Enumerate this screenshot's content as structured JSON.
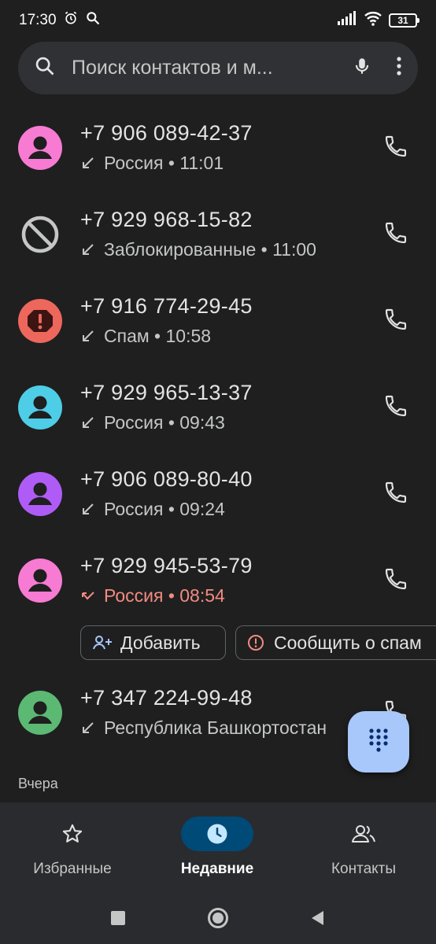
{
  "status_bar": {
    "time": "17:30",
    "battery": "31"
  },
  "search": {
    "placeholder": "Поиск контактов и м..."
  },
  "calls": [
    {
      "number": "+7 906 089-42-37",
      "info": "Россия • 11:01",
      "avatar_color": "#f77bd2",
      "type": "incoming"
    },
    {
      "number": "+7 929 968-15-82",
      "info": "Заблокированные • 11:00",
      "avatar_color": "none",
      "type": "blocked"
    },
    {
      "number": "+7 916 774-29-45",
      "info": "Спам • 10:58",
      "avatar_color": "#ee675c",
      "type": "spam"
    },
    {
      "number": "+7 929 965-13-37",
      "info": "Россия • 09:43",
      "avatar_color": "#4ecde6",
      "type": "incoming"
    },
    {
      "number": "+7 906 089-80-40",
      "info": "Россия • 09:24",
      "avatar_color": "#af5cf7",
      "type": "incoming"
    },
    {
      "number": "+7 929 945-53-79",
      "info": "Россия • 08:54",
      "avatar_color": "#f77bd2",
      "type": "missed"
    },
    {
      "number": "+7 347 224-99-48",
      "info": "Республика Башкортостан",
      "avatar_color": "#5bb974",
      "type": "incoming"
    }
  ],
  "actions": {
    "add_label": "Добавить",
    "report_spam_label": "Сообщить о спам"
  },
  "section": {
    "yesterday": "Вчера"
  },
  "bottom_nav": {
    "favorites": "Избранные",
    "recents": "Недавние",
    "contacts": "Контакты",
    "active": "recents"
  },
  "colors": {
    "accent": "#a8c7fa",
    "missed": "#f28b82",
    "nav_active_bg": "#004a77"
  }
}
